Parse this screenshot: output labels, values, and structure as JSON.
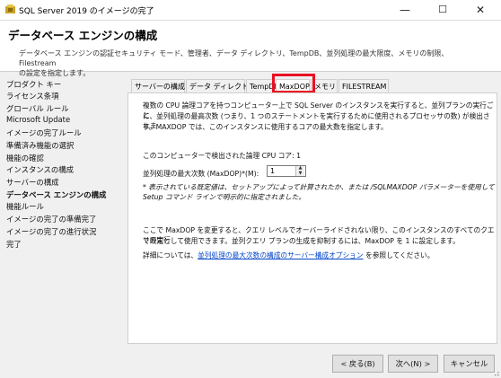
{
  "window": {
    "title": "SQL Server 2019 のイメージの完了",
    "minimize": "—",
    "maximize": "☐",
    "close": "✕"
  },
  "header": {
    "title": "データベース エンジンの構成",
    "desc_line1": "データベース エンジンの認証セキュリティ モード、管理者、データ ディレクトリ、TempDB、並列処理の最大限度、メモリの制限、Filestream",
    "desc_line2": "の設定を指定します。"
  },
  "sidebar": {
    "items": [
      {
        "label": "プロダクト キー"
      },
      {
        "label": "ライセンス条項"
      },
      {
        "label": "グローバル ルール"
      },
      {
        "label": "Microsoft Update"
      },
      {
        "label": "イメージの完了ルール"
      },
      {
        "label": "準備済み機能の選択"
      },
      {
        "label": "機能の確認"
      },
      {
        "label": "インスタンスの構成"
      },
      {
        "label": "サーバーの構成"
      },
      {
        "label": "データベース エンジンの構成"
      },
      {
        "label": "機能ルール"
      },
      {
        "label": "イメージの完了の準備完了"
      },
      {
        "label": "イメージの完了の進行状況"
      },
      {
        "label": "完了"
      }
    ]
  },
  "tabs": [
    {
      "label": "サーバーの構成"
    },
    {
      "label": "データ ディレクトリ"
    },
    {
      "label": "TempDB"
    },
    {
      "label": "MaxDOP"
    },
    {
      "label": "メモリ"
    },
    {
      "label": "FILESTREAM"
    }
  ],
  "maxdop": {
    "intro_1": "複数の CPU 論理コアを持つコンピューター上で SQL Server のインスタンスを実行すると、並列プランの実行ごと",
    "intro_2": "に、並列処理の最高次数 (つまり、1 つのステートメントを実行するために使用されるプロセッサの数) が検出されま",
    "intro_3": "す。MAXDOP では、このインスタンスに使用するコアの最大数を指定します。",
    "cores_detected": "このコンピューターで検出された論理 CPU コア: 1",
    "field_label": "並列処理の最大次数 (MaxDOP)*(M):",
    "field_value": "1",
    "note_1": "* 表示されている既定値は、セットアップによって計算されたか、または /SQLMAXDOP パラメーターを使用して",
    "note_2": "Setup コマンド ラインで明示的に指定されました。",
    "change_1": "ここで MaxDOP を変更すると、クエリ レベルでオーバーライドされない限り、このインスタンスのすべてのクエリの実行",
    "change_2": "で既定として使用できます。並列クエリ プランの生成を抑制するには、MaxDOP を 1 に設定します。",
    "detail_prefix": "詳細については、",
    "detail_link": "並列処理の最大次数の構成のサーバー構成オプション",
    "detail_suffix": " を参照してください。"
  },
  "buttons": {
    "back": "< 戻る(B)",
    "next": "次へ(N) >",
    "cancel": "キャンセル"
  }
}
